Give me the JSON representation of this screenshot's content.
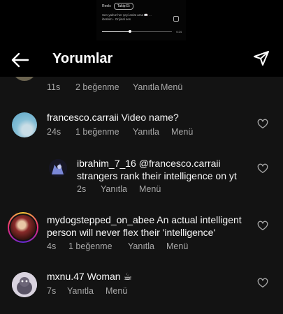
{
  "video": {
    "top_label": "Reels",
    "pill": "Takip Et",
    "caption": "Sen yalnız her şeyi anlat ama 📖 ...",
    "sub": "ibrahim · Orijinal ses",
    "time": "0:24",
    "progress": 0.4
  },
  "header": {
    "title": "Yorumlar",
    "back_icon": "arrow-left-icon",
    "send_icon": "paper-plane-icon"
  },
  "comments": [
    {
      "id": "top-partial",
      "time": "11s",
      "likes": "2 beğenme",
      "reply_label": "Yanıtla",
      "menu_label": "Menü"
    },
    {
      "id": "francesco",
      "user": "francesco.carraii",
      "text": "Video name?",
      "time": "24s",
      "likes": "1 beğenme",
      "reply_label": "Yanıtla",
      "menu_label": "Menü"
    },
    {
      "id": "ibrahim",
      "user": "ibrahim_7_16",
      "text_line1": "@francesco.carraii",
      "text_line2": "strangers rank their intelligence on yt",
      "time": "2s",
      "reply_label": "Yanıtla",
      "menu_label": "Menü"
    },
    {
      "id": "mydog",
      "user": "mydogstepped_on_abee",
      "text_line1": "An actual intelligent",
      "text_line2": "person will never flex their 'intelligence'",
      "time": "4s",
      "likes": "1 beğenme",
      "reply_label": "Yanıtla",
      "menu_label": "Menü"
    },
    {
      "id": "mxnu",
      "user": "mxnu.47",
      "text": "Woman ☕",
      "time": "7s",
      "reply_label": "Yanıtla",
      "menu_label": "Menü"
    }
  ],
  "colors": {
    "background": "#131313",
    "meta": "#a8a8a8",
    "text": "#f5f5f5"
  }
}
